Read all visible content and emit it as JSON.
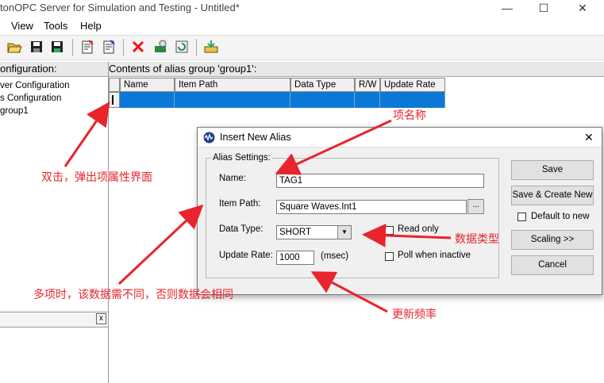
{
  "app": {
    "title": "tonOPC Server for Simulation and Testing - Untitled*",
    "window_controls": {
      "minimize": "—",
      "maximize": "☐",
      "close": "✕"
    }
  },
  "menu": [
    "View",
    "Tools",
    "Help"
  ],
  "toolbar": {
    "icons": [
      "open-folder-icon",
      "save-icon",
      "save-all-icon",
      "properties-icon",
      "edit-properties-icon",
      "delete-icon",
      "add-item-icon",
      "refresh-icon",
      "export-icon"
    ]
  },
  "left_pane": {
    "header": "onfiguration:",
    "tree": [
      "ver Configuration",
      "s Configuration",
      "group1"
    ],
    "sub_close": "x"
  },
  "right_pane": {
    "header": "Contents of alias group 'group1':",
    "columns": [
      "Name",
      "Item Path",
      "Data Type",
      "R/W",
      "Update Rate"
    ]
  },
  "dialog": {
    "title": "Insert New Alias",
    "close": "✕",
    "group_title": "Alias Settings:",
    "name_label": "Name:",
    "name_value": "TAG1",
    "item_path_label": "Item Path:",
    "item_path_value": "Square Waves.Int1",
    "browse_label": "...",
    "data_type_label": "Data Type:",
    "data_type_value": "SHORT",
    "read_only_label": "Read only",
    "update_rate_label": "Update Rate:",
    "update_rate_value": "1000",
    "update_rate_unit": "(msec)",
    "poll_label": "Poll when inactive",
    "save_button": "Save",
    "save_create_button": "Save & Create New",
    "default_to_new_label": "Default to new",
    "scaling_button": "Scaling >>",
    "cancel_button": "Cancel"
  },
  "annotations": {
    "item_name": "项名称",
    "double_click": "双击，弹出项属性界面",
    "data_type": "数据类型",
    "multi_items": "多项时，该数据需不同，否则数据会相同",
    "update_rate": "更新频率"
  },
  "colors": {
    "selection": "#0b78d7",
    "annotation": "#e8242c"
  }
}
